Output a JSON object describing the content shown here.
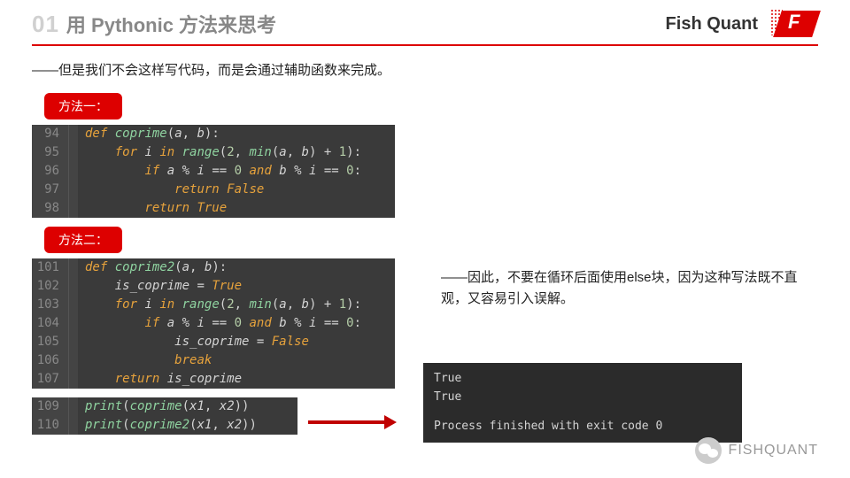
{
  "header": {
    "section_num": "01",
    "section_title": "用 Pythonic 方法来思考",
    "brand": "Fish Quant",
    "logo_letter": "F"
  },
  "intro": "——但是我们不会这样写代码，而是会通过辅助函数来完成。",
  "method1_label": "方法一：",
  "method2_label": "方法二：",
  "code1": {
    "start": 94,
    "lines": [
      {
        "n": "94",
        "html": "<span class='kw'>def</span> <span class='fn'>coprime</span>(<span class='var'>a</span>, <span class='var'>b</span>):"
      },
      {
        "n": "95",
        "html": "    <span class='kw'>for</span> <span class='var'>i</span> <span class='kw'>in</span> <span class='fn'>range</span>(<span class='num'>2</span>, <span class='fn'>min</span>(<span class='var'>a</span>, <span class='var'>b</span>) + <span class='num'>1</span>):"
      },
      {
        "n": "96",
        "html": "        <span class='kw'>if</span> <span class='var'>a</span> % <span class='var'>i</span> == <span class='num'>0</span> <span class='kw'>and</span> <span class='var'>b</span> % <span class='var'>i</span> == <span class='num'>0</span>:"
      },
      {
        "n": "97",
        "html": "            <span class='kw'>return</span> <span class='bool'>False</span>"
      },
      {
        "n": "98",
        "html": "        <span class='kw'>return</span> <span class='bool'>True</span>"
      }
    ]
  },
  "code2": {
    "lines": [
      {
        "n": "101",
        "html": "<span class='kw'>def</span> <span class='fn'>coprime2</span>(<span class='var'>a</span>, <span class='var'>b</span>):"
      },
      {
        "n": "102",
        "html": "    <span class='var'>is_coprime</span> = <span class='bool'>True</span>"
      },
      {
        "n": "103",
        "html": "    <span class='kw'>for</span> <span class='var'>i</span> <span class='kw'>in</span> <span class='fn'>range</span>(<span class='num'>2</span>, <span class='fn'>min</span>(<span class='var'>a</span>, <span class='var'>b</span>) + <span class='num'>1</span>):"
      },
      {
        "n": "104",
        "html": "        <span class='kw'>if</span> <span class='var'>a</span> % <span class='var'>i</span> == <span class='num'>0</span> <span class='kw'>and</span> <span class='var'>b</span> % <span class='var'>i</span> == <span class='num'>0</span>:"
      },
      {
        "n": "105",
        "html": "            <span class='var'>is_coprime</span> = <span class='bool'>False</span>"
      },
      {
        "n": "106",
        "html": "            <span class='kw'>break</span>"
      },
      {
        "n": "107",
        "html": "    <span class='kw'>return</span> <span class='var'>is_coprime</span>"
      }
    ]
  },
  "code_print": {
    "lines": [
      {
        "n": "109",
        "html": "<span class='fn'>print</span>(<span class='fn'>coprime</span>(<span class='var'>x1</span>, <span class='var'>x2</span>))"
      },
      {
        "n": "110",
        "html": "<span class='fn'>print</span>(<span class='fn'>coprime2</span>(<span class='var'>x1</span>, <span class='var'>x2</span>))"
      }
    ]
  },
  "conclusion": "——因此，不要在循环后面使用else块，因为这种写法既不直观，又容易引入误解。",
  "output": {
    "line1": "True",
    "line2": "True",
    "line3": "Process finished with exit code 0"
  },
  "watermark": "FISHQUANT"
}
